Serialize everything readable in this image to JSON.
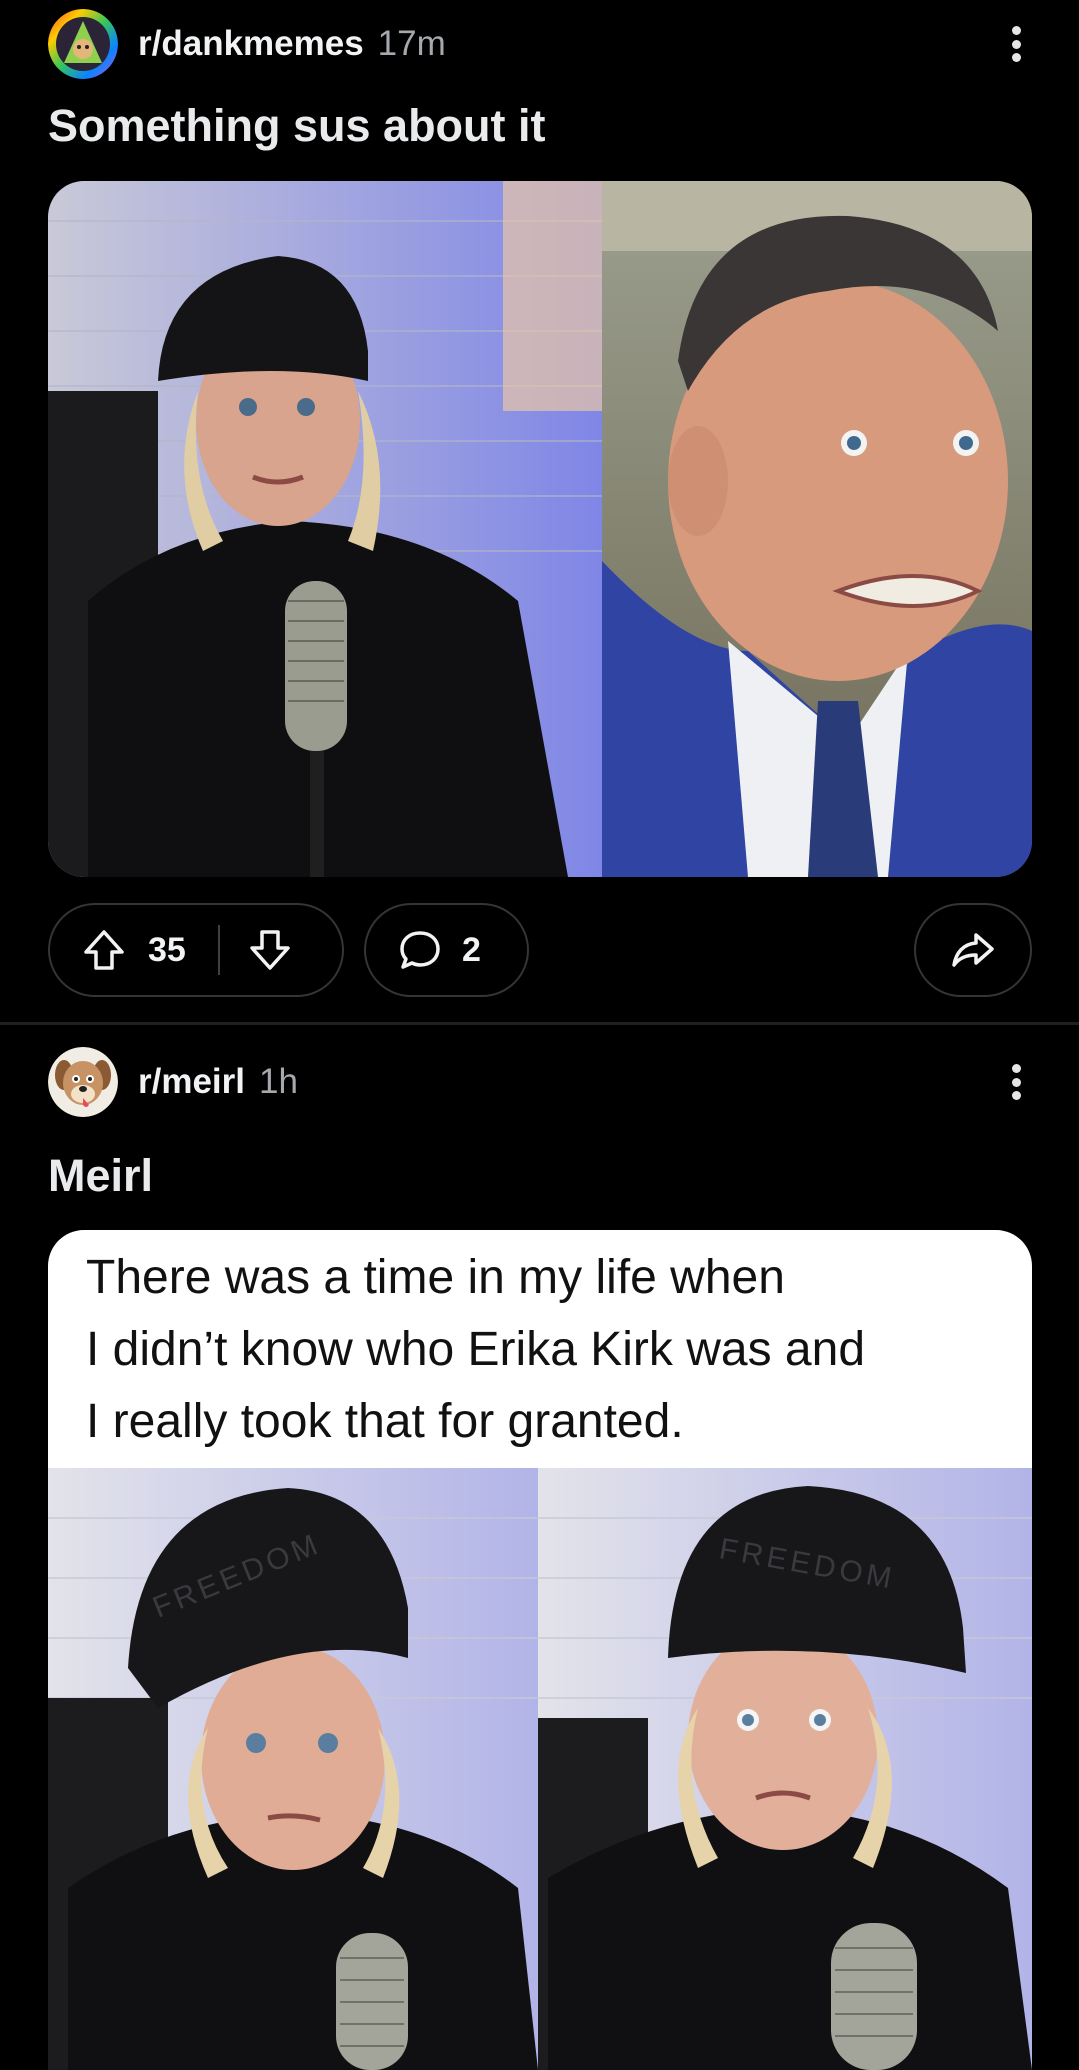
{
  "posts": [
    {
      "subreddit": "r/dankmemes",
      "time": "17m",
      "title": "Something sus about it",
      "upvotes": "35",
      "comments": "2",
      "avatar_icon": "rainbow-triangle-avatar-icon",
      "media": "two-panel photo meme"
    },
    {
      "subreddit": "r/meirl",
      "time": "1h",
      "title": "Meirl",
      "media_text": [
        "There was a time in my life when",
        "I didn’t know who Erika Kirk was and",
        "I really took that for granted."
      ],
      "hat_text": "FREEDOM",
      "avatar_icon": "cartoon-dog-avatar-icon",
      "media": "text caption with two photo panels"
    }
  ],
  "colors": {
    "background": "#000000",
    "text": "#f2f3f5",
    "muted": "#a5a8ad",
    "pill_border": "#34353a"
  }
}
